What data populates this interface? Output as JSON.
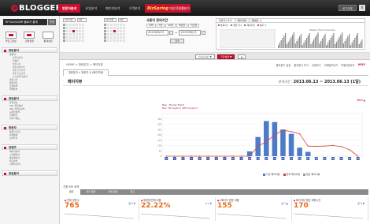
{
  "app": {
    "logo_text": "BLOGGER",
    "nav": [
      "방문자분석",
      "유입분석",
      "페이지분석",
      "고객분석"
    ],
    "promo": {
      "prefix": "BizSpring",
      "text": "대상전환률분석"
    },
    "user_button": "로그아웃",
    "close_label": "x"
  },
  "sidebar": {
    "account": "TIP BLOGGER 블로거 통계",
    "account_go": "변경",
    "quick": [
      {
        "label": "블로그정보",
        "icon": "blog-icon"
      },
      {
        "label": "환경설정",
        "icon": "settings-icon"
      },
      {
        "label": "통계설정",
        "icon": "stats-icon"
      }
    ],
    "sections": [
      {
        "title": "방문분석",
        "items": [
          {
            "label": "방문자",
            "sub": false
          },
          {
            "label": "방문자분석",
            "sub": true
          },
          {
            "label": "재방문",
            "sub": true
          },
          {
            "label": "방문시간",
            "sub": true
          },
          {
            "label": "페이지뷰분석",
            "sub": true
          },
          {
            "label": "방문 일수분석",
            "sub": true
          },
          {
            "label": "방문 빈도분석",
            "sub": true
          },
          {
            "label": "신규방문/재방문",
            "sub": true
          },
          {
            "label": "체류시간",
            "sub": false
          },
          {
            "label": "방문경로",
            "sub": false
          },
          {
            "label": "요일분석",
            "sub": false
          },
          {
            "label": "월별분석",
            "sub": false
          }
        ]
      },
      {
        "title": "유입분석",
        "items": [
          {
            "label": "유입경로",
            "sub": false
          },
          {
            "label": "URL 유입분석",
            "sub": false
          },
          {
            "label": "URL 키워드분석",
            "sub": false
          },
          {
            "label": "도메인분석",
            "sub": false
          },
          {
            "label": "검색엔진",
            "sub": false
          },
          {
            "label": "검색 키워드",
            "sub": false
          }
        ]
      },
      {
        "title": "방문자",
        "items": [
          {
            "label": "방문자 환경",
            "sub": false
          },
          {
            "label": "운영체제",
            "sub": false
          },
          {
            "label": "브라우저",
            "sub": false
          }
        ]
      },
      {
        "title": "컨텐츠",
        "items": [
          {
            "label": "페이지분석",
            "sub": false
          },
          {
            "label": "시작페이지",
            "sub": false
          },
          {
            "label": "종료페이지",
            "sub": false
          },
          {
            "label": "태그분석",
            "sub": false
          },
          {
            "label": "검색어 분석",
            "sub": false
          }
        ]
      },
      {
        "title": "유입분석",
        "items": []
      }
    ]
  },
  "filter": {
    "cal1": {
      "year": "2013년",
      "month": "6월"
    },
    "cal2": {
      "year": "2013년",
      "month": "6월"
    },
    "period_title": "사용자 정의기간",
    "period_buttons": [
      "어제",
      "7일",
      "30일",
      "이번달",
      "지난달"
    ],
    "from": "2013/06/13",
    "to": "2013/06/13",
    "apply": "검색",
    "mini_tabs": [
      "방문자수추이",
      "페이지뷰",
      "재방문"
    ],
    "mini_legend": [
      "방문자수",
      "방문 일수",
      "페이지뷰",
      "방문 수"
    ],
    "mini_caption": "Weekly Trend Overview"
  },
  "toolbar": {
    "btn1": "Calendar ▼",
    "btn2": "기간설정 ▼",
    "btn3": "▲"
  },
  "breadcrumb": "HOME > 방문분석 > 페이지뷰",
  "crumb_tools": [
    "즐겨찾기 설정",
    "즐겨찾기 추가",
    "인쇄하기",
    "이메일보내기",
    "엑셀다운로드"
  ],
  "help_label": "HELP",
  "main": {
    "tab": "방문분석 > 방문자 수 (페이지뷰)",
    "title": "페이지뷰",
    "range_label": "분석기간 :",
    "range_value": "2013.06.13 ~ 2013.06.13 (1일)",
    "total_link": "Total ▲"
  },
  "chart_data": {
    "type": "bar",
    "title": "Day : Hourly Trend",
    "subtitle": "Max: 358  Avg/min: 298  Forecast: 0",
    "x": [
      "0",
      "1",
      "2",
      "3",
      "4",
      "5",
      "6",
      "7",
      "8",
      "9",
      "10",
      "11",
      "12",
      "13",
      "14",
      "15",
      "16",
      "17",
      "18",
      "19",
      "20",
      "21",
      "22",
      "23"
    ],
    "series": [
      {
        "name": "이전 페이지뷰",
        "kind": "line",
        "color": "#d84444",
        "values": [
          0,
          0,
          0,
          0,
          0,
          0,
          0,
          0,
          0,
          0,
          0,
          95,
          135,
          200,
          245,
          230,
          210,
          95,
          92,
          95,
          100,
          90,
          60,
          0
        ]
      },
      {
        "name": "현재 페이지뷰",
        "kind": "bar",
        "color": "#4d7bc7",
        "values": [
          0,
          0,
          0,
          0,
          0,
          0,
          0,
          0,
          0,
          0,
          45,
          180,
          330,
          320,
          250,
          210,
          80,
          40,
          0,
          0,
          0,
          0,
          0,
          0
        ]
      }
    ],
    "ylim": [
      0,
      400
    ],
    "yticks": [
      0,
      50,
      100,
      150,
      200,
      250,
      300,
      350
    ],
    "legend": [
      "이전 페이지뷰",
      "현재 페이지뷰",
      "평균 페이지뷰"
    ]
  },
  "kpi": {
    "header": "기준 KPI 요약",
    "tabs": [
      "평균",
      "전주 평균",
      "전월 평균",
      "최고"
    ],
    "cards": [
      {
        "label": "전체 방문수",
        "value": "765",
        "delta": "증가 ▼"
      },
      {
        "label": "재방문/전체 비율",
        "value": "22.22%",
        "delta": "0.1 ▼"
      },
      {
        "label": "1페이지 방문 비율",
        "value": "155",
        "delta": "증가 ▲"
      },
      {
        "label": "페이지당 평균 체류시간",
        "value": "170",
        "delta": "증가 ▼"
      }
    ]
  },
  "colors": {
    "accent": "#c8102e",
    "bar": "#4d7bc7",
    "line": "#d84444",
    "kpi": "#e86a16"
  }
}
